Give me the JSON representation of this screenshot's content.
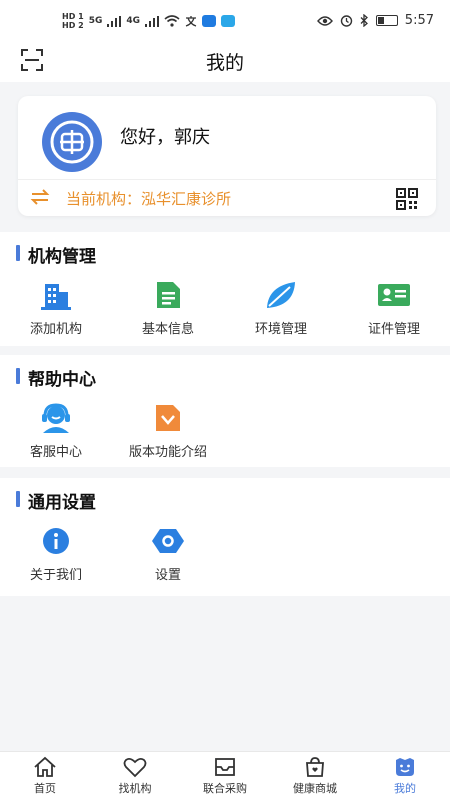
{
  "status_bar": {
    "hd1": "HD 1",
    "hd2": "HD 2",
    "net1": "5G",
    "net2": "4G",
    "time": "5:57"
  },
  "header": {
    "title": "我的"
  },
  "profile": {
    "greeting": "您好，郭庆",
    "org_label": "当前机构：泓华汇康诊所"
  },
  "sections": {
    "org_management": {
      "title": "机构管理",
      "items": [
        "添加机构",
        "基本信息",
        "环境管理",
        "证件管理"
      ]
    },
    "help_center": {
      "title": "帮助中心",
      "items": [
        "客服中心",
        "版本功能介绍"
      ]
    },
    "general_settings": {
      "title": "通用设置",
      "items": [
        "关于我们",
        "设置"
      ]
    }
  },
  "tabbar": {
    "items": [
      "首页",
      "找机构",
      "联合采购",
      "健康商城",
      "我的"
    ],
    "active_index": 4
  },
  "colors": {
    "accent": "#4a7bd9",
    "org_text": "#e8902c",
    "green": "#3aaa5c",
    "orange": "#f08a3a",
    "light_blue": "#2b95e9"
  }
}
